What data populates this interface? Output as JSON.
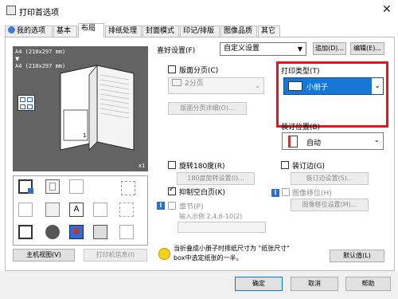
{
  "window": {
    "title": "打印首选项",
    "close_glyph": "✕"
  },
  "tabs": [
    {
      "label": "我的选项",
      "icon": "user-icon"
    },
    {
      "label": "基本"
    },
    {
      "label": "布局"
    },
    {
      "label": "排纸处理"
    },
    {
      "label": "封面模式"
    },
    {
      "label": "印记/排版"
    },
    {
      "label": "图像品质"
    },
    {
      "label": "其它"
    }
  ],
  "preview": {
    "line1": "A4 (210x297 mm)",
    "line2": "A4 (210x297 mm)",
    "scale": "x1"
  },
  "left_buttons": {
    "main_view": "主机视图(V)",
    "printer_info": "打印机信息(I)"
  },
  "favorites": {
    "label": "喜好设置(F)",
    "value": "自定义设置",
    "add": "追加(D)...",
    "edit": "编辑(E)..."
  },
  "combination": {
    "label": "版面分页(C)",
    "value": "2分页",
    "detail": "版面分页详细(O)..."
  },
  "print_type": {
    "label": "打印类型(T)",
    "value": "小册子"
  },
  "binding": {
    "label": "装订位置(B)",
    "value": "自动"
  },
  "rotate": {
    "label": "旋转180度(R)",
    "detail": "180度旋转设置(I)..."
  },
  "skip_blank": {
    "label": "抑制空白页(K)"
  },
  "chapter": {
    "label": "章节(P)",
    "hint": "输入示例 2,4,6-10(2)"
  },
  "binding_margin": {
    "label": "装订边(G)",
    "detail": "装订边设置(S)..."
  },
  "image_shift": {
    "label": "图像移位(H)",
    "detail": "图像移位设置(M)..."
  },
  "message": {
    "text1": "当折叠成小册子时排纸尺寸为 \"纸张尺寸\"",
    "text2": "box中选定纸张的一半。"
  },
  "default_button": "默认值(L)",
  "footer": {
    "ok": "确定",
    "cancel": "取消",
    "help": "帮助"
  },
  "colors": {
    "accent": "#1877d6",
    "highlight_border": "#e6151d",
    "preview_bg": "#636363"
  }
}
